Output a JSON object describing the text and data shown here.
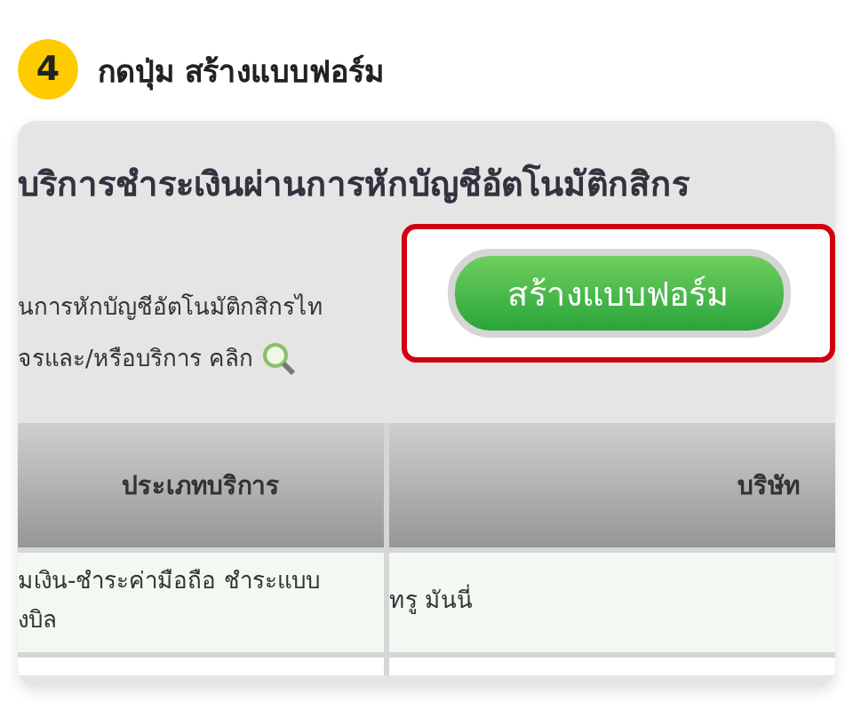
{
  "step": {
    "number": "4",
    "title": "กดปุ่ม สร้างแบบฟอร์ม"
  },
  "panel": {
    "title": "บริการชำระเงินผ่านการหักบัญชีอัตโนมัติกสิกร",
    "description_lines": [
      "นการหักบัญชีอัตโนมัติกสิกรไท",
      "จรและ/หรือบริการ คลิก"
    ],
    "button": "สร้างแบบฟอร์ม",
    "table": {
      "columns": [
        "ประเภทบริการ",
        "บริษัท"
      ],
      "rows": [
        [
          "มเงิน-ชำระค่ามือถือ ชำระแบบ\nงบิล",
          "ทรู มันนี่"
        ]
      ]
    }
  }
}
